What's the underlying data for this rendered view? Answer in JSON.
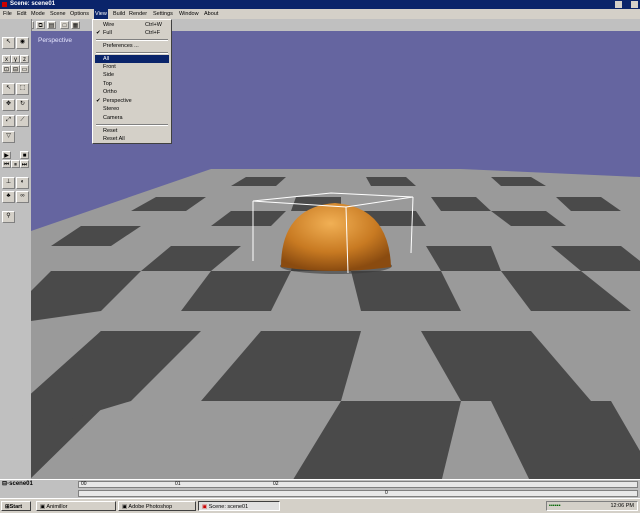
{
  "window": {
    "title": "Scene: scene01"
  },
  "menubar": {
    "items": [
      "File",
      "Edit",
      "Mode",
      "Scene",
      "Options",
      "View",
      "Build",
      "Render",
      "Settings",
      "Window",
      "About"
    ],
    "active": "View"
  },
  "view_menu": {
    "wire": {
      "label": "Wire",
      "shortcut": "Ctrl+W"
    },
    "full": {
      "label": "Full",
      "shortcut": "Ctrl+F",
      "checked": "✔"
    },
    "preferences": "Preferences ...",
    "all": "All",
    "front": "Front",
    "side": "Side",
    "top": "Top",
    "ortho": "Ortho",
    "perspective": {
      "label": "Perspective",
      "checked": "✔"
    },
    "stereo": "Stereo",
    "camera": "Camera",
    "reset": "Reset",
    "reset_all": "Reset All"
  },
  "viewport": {
    "label": "Perspective",
    "background": "#6565a0"
  },
  "statusbar": {
    "scene": "scene01",
    "ticks": [
      "00",
      "01",
      "02"
    ],
    "value": "0"
  },
  "taskbar": {
    "start": "Start",
    "tasks": [
      "Animillor",
      "Adobe Photoshop",
      "Scene: scene01"
    ],
    "clock": "12:06 PM"
  }
}
